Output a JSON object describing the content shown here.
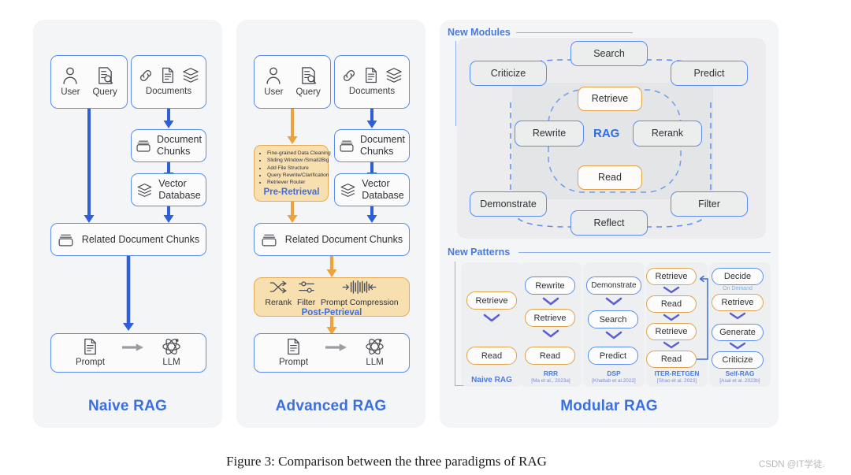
{
  "figure": {
    "caption": "Figure 3: Comparison between the three paradigms of RAG",
    "watermark": "CSDN @IT学徒."
  },
  "colors": {
    "panel_bg": "#f4f5f7",
    "blue_accent": "#3b6fe0",
    "blue_border": "#5b8def",
    "orange_border": "#e0a24a",
    "amber_fill": "#f8dfb0",
    "arrow_blue": "#2f5fd8",
    "arrow_orange": "#eda33a"
  },
  "panels": [
    {
      "id": "naive",
      "title": "Naive RAG",
      "nodes": {
        "user_query": {
          "icons": [
            "user-icon",
            "query-icon"
          ],
          "captions": [
            "User",
            "Query"
          ]
        },
        "documents": {
          "icons": [
            "link-icon",
            "file-icon",
            "layers-icon"
          ],
          "caption": "Documents"
        },
        "document_chunks": {
          "icon": "chunks-icon",
          "label": "Document\nChunks",
          "line1": "Document",
          "line2": "Chunks"
        },
        "vector_database": {
          "icon": "layers-icon",
          "label": "Vector\nDatabase",
          "line1": "Vector",
          "line2": "Database"
        },
        "related_chunks": {
          "icon": "chunks-icon",
          "label": "Related Document Chunks"
        },
        "prompt_llm": {
          "icons": [
            "prompt-icon",
            "arrow-right-icon",
            "llm-icon"
          ],
          "captions": [
            "Prompt",
            "LLM"
          ]
        }
      }
    },
    {
      "id": "advanced",
      "title": "Advanced RAG",
      "nodes": {
        "user_query": {
          "captions": [
            "User",
            "Query"
          ]
        },
        "documents": {
          "caption": "Documents"
        },
        "document_chunks": {
          "line1": "Document",
          "line2": "Chunks"
        },
        "vector_database": {
          "line1": "Vector",
          "line2": "Database"
        },
        "related_chunks": {
          "label": "Related Document Chunks"
        },
        "prompt_llm": {
          "captions": [
            "Prompt",
            "LLM"
          ]
        }
      },
      "pre_retrieval": {
        "stage_label": "Pre-Retrieval",
        "bullets": [
          "Fine-grained Data Cleaning",
          "Sliding Window /Small2Big",
          "Add File Structure",
          "Query Rewrite/Clarification",
          "Retriever Router"
        ]
      },
      "post_retrieval": {
        "stage_label": "Post-Petrieval",
        "items": [
          {
            "icon": "shuffle-icon",
            "caption": "Rerank"
          },
          {
            "icon": "sliders-icon",
            "caption": "Filter"
          },
          {
            "icon": "compress-icon",
            "caption": "Prompt Compression"
          }
        ]
      }
    },
    {
      "id": "modular",
      "title": "Modular RAG",
      "sections": {
        "new_modules": {
          "label": "New Modules",
          "center_label": "RAG",
          "outer_modules": [
            "Search",
            "Criticize",
            "Predict",
            "Demonstrate",
            "Filter",
            "Reflect"
          ],
          "inner_modules": [
            {
              "label": "Retrieve",
              "style": "orange"
            },
            {
              "label": "Rewrite",
              "style": "blue"
            },
            {
              "label": "Rerank",
              "style": "blue"
            },
            {
              "label": "Read",
              "style": "orange"
            }
          ]
        },
        "new_patterns": {
          "label": "New Patterns",
          "columns": [
            {
              "name": "Naive RAG",
              "citation": "",
              "steps": [
                {
                  "label": "Retrieve",
                  "style": "orange"
                },
                {
                  "label": "Read",
                  "style": "orange"
                }
              ]
            },
            {
              "name": "RRR",
              "citation": "[Ma et al., 2023a]",
              "steps": [
                {
                  "label": "Rewrite",
                  "style": "blue"
                },
                {
                  "label": "Retrieve",
                  "style": "orange"
                },
                {
                  "label": "Read",
                  "style": "orange"
                }
              ]
            },
            {
              "name": "DSP",
              "citation": "[Khattab et al.2022]",
              "steps": [
                {
                  "label": "Demonstrate",
                  "style": "blue"
                },
                {
                  "label": "Search",
                  "style": "blue"
                },
                {
                  "label": "Predict",
                  "style": "blue"
                }
              ]
            },
            {
              "name": "ITER-RETGEN",
              "citation": "[Shao et al. 2023]",
              "steps": [
                {
                  "label": "Retrieve",
                  "style": "orange"
                },
                {
                  "label": "Read",
                  "style": "orange"
                },
                {
                  "label": "Retrieve",
                  "style": "orange"
                },
                {
                  "label": "Read",
                  "style": "orange"
                }
              ]
            },
            {
              "name": "Self-RAG",
              "citation": "[Asai et al. 2023b]",
              "annotation": "On Demand",
              "steps": [
                {
                  "label": "Decide",
                  "style": "blue"
                },
                {
                  "label": "Retrieve",
                  "style": "orange"
                },
                {
                  "label": "Generate",
                  "style": "blue"
                },
                {
                  "label": "Criticize",
                  "style": "blue"
                }
              ]
            }
          ]
        }
      }
    }
  ]
}
